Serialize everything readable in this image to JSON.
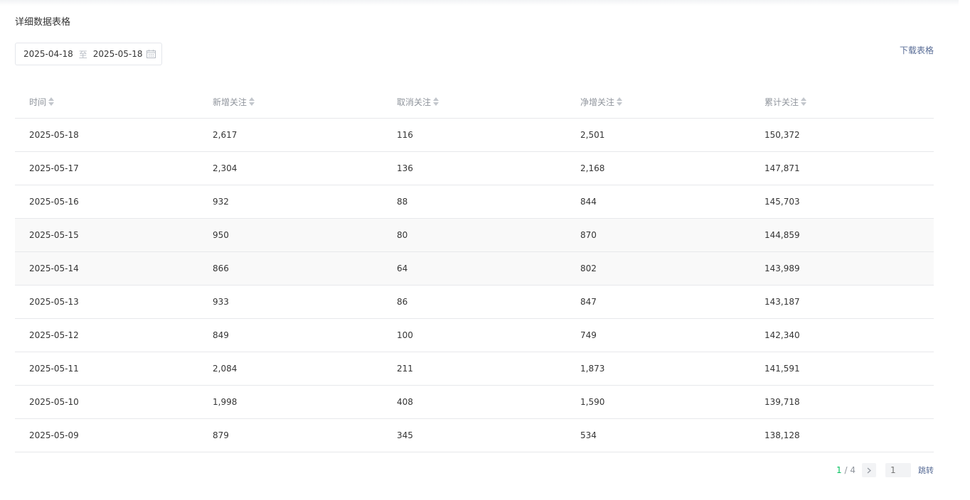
{
  "title": "详细数据表格",
  "date_range": {
    "start": "2025-04-18",
    "separator": "至",
    "end": "2025-05-18"
  },
  "download_label": "下载表格",
  "columns": [
    "时间",
    "新增关注",
    "取消关注",
    "净增关注",
    "累计关注"
  ],
  "rows": [
    [
      "2025-05-18",
      "2,617",
      "116",
      "2,501",
      "150,372"
    ],
    [
      "2025-05-17",
      "2,304",
      "136",
      "2,168",
      "147,871"
    ],
    [
      "2025-05-16",
      "932",
      "88",
      "844",
      "145,703"
    ],
    [
      "2025-05-15",
      "950",
      "80",
      "870",
      "144,859"
    ],
    [
      "2025-05-14",
      "866",
      "64",
      "802",
      "143,989"
    ],
    [
      "2025-05-13",
      "933",
      "86",
      "847",
      "143,187"
    ],
    [
      "2025-05-12",
      "849",
      "100",
      "749",
      "142,340"
    ],
    [
      "2025-05-11",
      "2,084",
      "211",
      "1,873",
      "141,591"
    ],
    [
      "2025-05-10",
      "1,998",
      "408",
      "1,590",
      "139,718"
    ],
    [
      "2025-05-09",
      "879",
      "345",
      "534",
      "138,128"
    ]
  ],
  "highlighted_rows": [
    3,
    4
  ],
  "pagination": {
    "current": "1",
    "total": "4",
    "jump_placeholder": "1",
    "jump_label": "跳转"
  },
  "icons": {
    "calendar": "calendar-icon",
    "sort": "sort-icon",
    "next": "chevron-right-icon"
  },
  "colors": {
    "link": "#576b95",
    "current_page": "#07c160"
  }
}
